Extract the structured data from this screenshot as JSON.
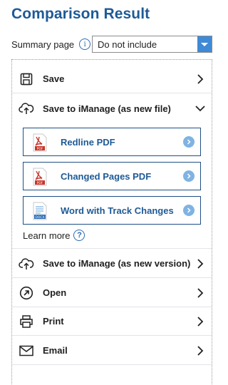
{
  "header": {
    "title": "Comparison Result"
  },
  "summary": {
    "label": "Summary page",
    "info_glyph": "i",
    "selected_value": "Do not include"
  },
  "actions": {
    "save": "Save",
    "save_imanage_new_file": "Save to iManage (as new file)",
    "save_imanage_new_version": "Save to iManage (as new version)",
    "open": "Open",
    "print": "Print",
    "email": "Email"
  },
  "export_options": {
    "redline_pdf": {
      "label": "Redline PDF",
      "icon_text": "PDF"
    },
    "changed_pages_pdf": {
      "label": "Changed Pages PDF",
      "icon_text": "PDF"
    },
    "word_track_changes": {
      "label": "Word with Track Changes",
      "icon_text": "DOCX"
    }
  },
  "learn_more": {
    "label": "Learn more",
    "help_glyph": "?"
  },
  "colors": {
    "title": "#1e5a96",
    "accent": "#3f8ad6",
    "button_border": "#1e4f85",
    "go_circle": "#7fb3e3",
    "pdf_red": "#c8362b",
    "docx_blue": "#2a6cb5"
  }
}
